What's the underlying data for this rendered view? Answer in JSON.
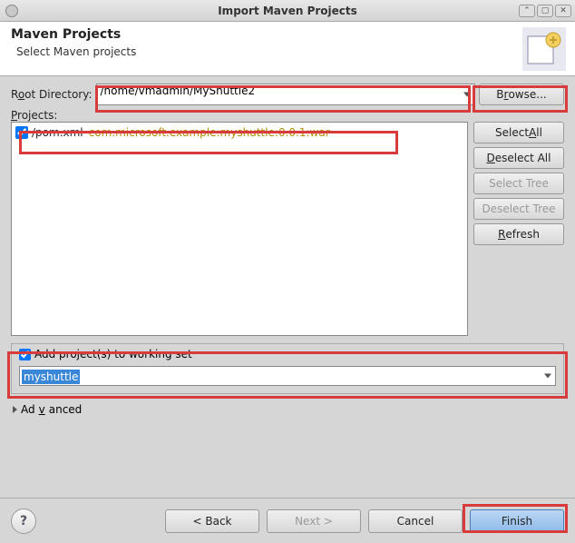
{
  "titlebar": {
    "title": "Import Maven Projects",
    "min": "⌃",
    "max": "▢",
    "close": "✕"
  },
  "banner": {
    "title": "Maven Projects",
    "subtitle": "Select Maven projects"
  },
  "root_dir": {
    "label_pre": "R",
    "label_u": "o",
    "label_post": "ot Directory:",
    "value": "/home/vmadmin/MyShuttle2",
    "browse_pre": "B",
    "browse_u": "r",
    "browse_post": "owse..."
  },
  "projects": {
    "label_u": "P",
    "label_post": "rojects:",
    "items": [
      {
        "checked": true,
        "file": "/pom.xml",
        "coords": "com.microsoft.example:myshuttle:0.0.1:war"
      }
    ],
    "buttons": {
      "select_all": "Select All",
      "select_all_u": "A",
      "deselect_all": "Deselect All",
      "deselect_all_u": "D",
      "select_tree": "Select Tree",
      "deselect_tree": "Deselect Tree",
      "refresh": "Refresh",
      "refresh_u": "R"
    }
  },
  "working_set": {
    "label": "Add project(s) to working set",
    "value": "myshuttle"
  },
  "advanced": {
    "label_pre": "Ad",
    "label_u": "v",
    "label_post": "anced"
  },
  "footer": {
    "back": "< Back",
    "next": "Next >",
    "cancel": "Cancel",
    "finish": "Finish"
  }
}
